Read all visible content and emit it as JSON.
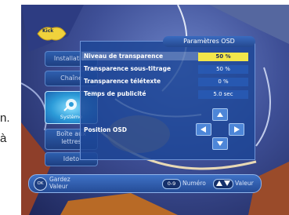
{
  "side_text": [
    "n.",
    "à"
  ],
  "logo": "Kick",
  "sidebar": {
    "items": [
      {
        "label": "Installation"
      },
      {
        "label": "Chaîne"
      },
      {
        "label": "Système"
      },
      {
        "label": "Boîte aux lettres"
      },
      {
        "label": "Ideto"
      }
    ]
  },
  "panel": {
    "title": "Paramètres OSD",
    "rows": [
      {
        "label": "Niveau de transparence",
        "value": "50 %",
        "selected": true
      },
      {
        "label": "Transparence sous-titrage",
        "value": "50 %",
        "selected": false
      },
      {
        "label": "Transparence télétexte",
        "value": "0 %",
        "selected": false
      },
      {
        "label": "Temps de publicité",
        "value": "5.0 sec",
        "selected": false
      }
    ],
    "position_label": "Position OSD"
  },
  "footer": {
    "ok": "OK",
    "left_line1": "Gardez",
    "left_line2": "Valeur",
    "numeric_key": "0-9",
    "numeric_label": "Numéro",
    "arrows_label": "Valeur"
  },
  "colors": {
    "panel": "#1c4696",
    "selected_value": "#f2e64a",
    "menu_item": "#2e5fae",
    "accent": "#4d86d8"
  }
}
